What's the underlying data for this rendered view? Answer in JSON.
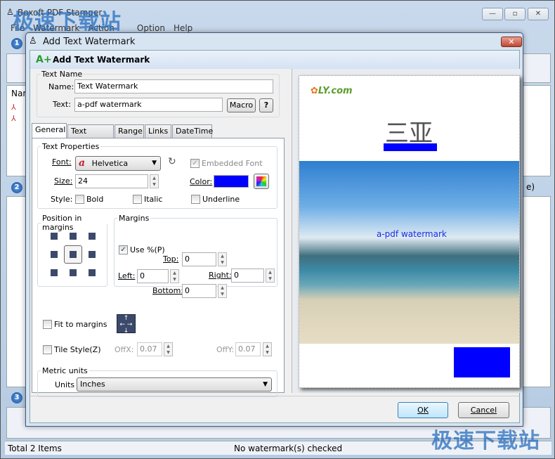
{
  "app": {
    "title": "Boxoft PDF Stamper",
    "menu": [
      "File",
      "Watermark",
      "Action",
      "Option",
      "Help"
    ],
    "steps": [
      "1",
      "2",
      "3"
    ],
    "list_header": "Nam",
    "status_left": "Total 2 Items",
    "status_mid": "No watermark(s) checked",
    "side_text": "e)"
  },
  "overlay_watermark": "极速下载站",
  "dialog": {
    "title": "Add Text Watermark",
    "header": "Add Text Watermark",
    "close": "✕",
    "text_name": {
      "legend": "Text Name",
      "name_label": "Name:",
      "name_value": "Text Watermark",
      "text_label": "Text:",
      "text_value": "a-pdf watermark",
      "macro": "Macro",
      "help": "?"
    },
    "tabs": [
      "General",
      "Text Effect",
      "Range",
      "Links",
      "DateTime"
    ],
    "active_tab": "General",
    "text_props": {
      "legend": "Text Properties",
      "font_label": "Font:",
      "font_value": "Helvetica",
      "embedded_label": "Embedded Font",
      "embedded_checked": true,
      "size_label": "Size:",
      "size_value": "24",
      "color_label": "Color:",
      "color_value": "#0000ff",
      "style_label": "Style:",
      "bold": "Bold",
      "italic": "Italic",
      "underline": "Underline"
    },
    "position": {
      "legend": "Position in margins",
      "selected": "center"
    },
    "margins": {
      "legend": "Margins",
      "use_pct": "Use %(P)",
      "use_pct_checked": true,
      "top_label": "Top:",
      "top": "0",
      "left_label": "Left:",
      "left": "0",
      "right_label": "Right:",
      "right": "0",
      "bottom_label": "Bottom:",
      "bottom": "0"
    },
    "fit_label": "Fit to margins",
    "tile_label": "Tile Style(Z)",
    "offx_label": "OffX:",
    "offx": "0.07",
    "offy_label": "OffY:",
    "offy": "0.07",
    "metric": {
      "legend": "Metric units",
      "units_label": "Units",
      "units_value": "Inches"
    },
    "preview": {
      "logo": "LY.com",
      "heading": "三亚",
      "watermark_text": "a-pdf watermark",
      "accent": "#0000ff"
    },
    "ok": "OK",
    "cancel": "Cancel"
  }
}
